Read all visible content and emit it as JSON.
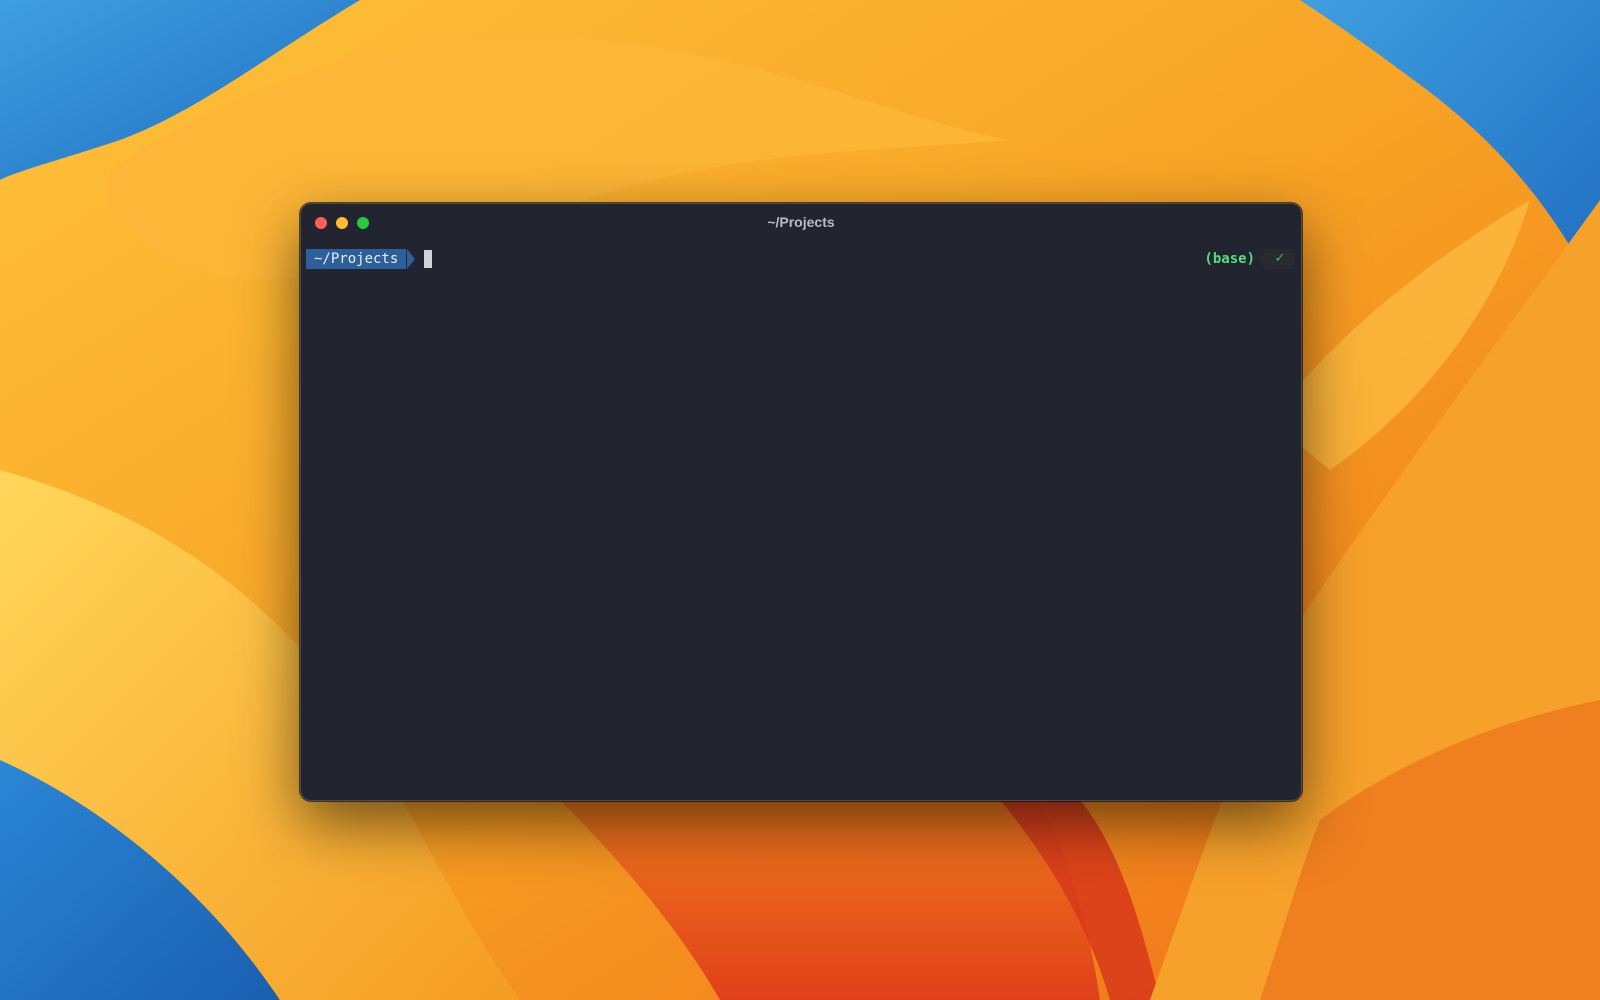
{
  "window": {
    "title": "~/Projects"
  },
  "prompt": {
    "directory": "~/Projects",
    "env": "(base)",
    "status_symbol": "✓"
  },
  "colors": {
    "terminal_bg": "#22242f",
    "prompt_segment": "#2d5f9a",
    "env_text": "#4ee07a",
    "status_ok": "#3fbf57",
    "close": "#ff5f57",
    "minimize": "#febc2e",
    "zoom": "#28c840"
  },
  "icons": {
    "close": "close-button",
    "minimize": "minimize-button",
    "zoom": "zoom-button",
    "status": "checkmark-icon"
  }
}
